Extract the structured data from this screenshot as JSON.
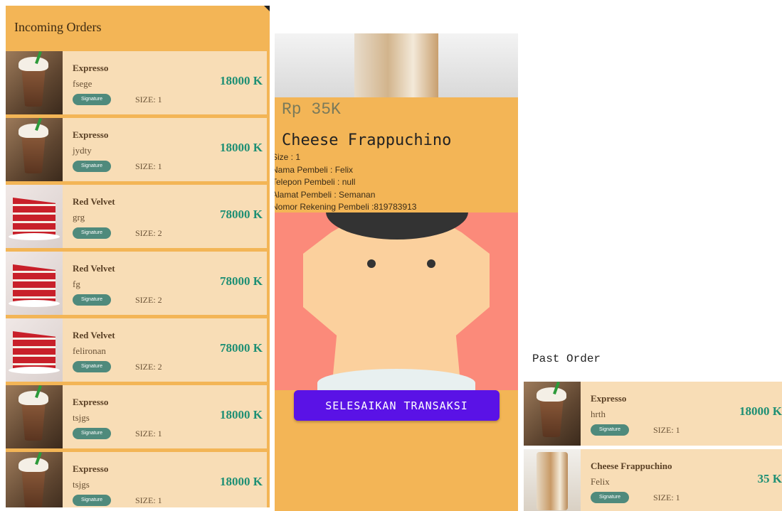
{
  "incoming": {
    "title": "Incoming Orders",
    "orders": [
      {
        "name": "Expresso",
        "buyer": "fsege",
        "badge": "Signature",
        "size": "SIZE: 1",
        "price": "18000 K",
        "thumb": "coffee"
      },
      {
        "name": "Expresso",
        "buyer": "jydty",
        "badge": "Signature",
        "size": "SIZE: 1",
        "price": "18000 K",
        "thumb": "coffee"
      },
      {
        "name": "Red Velvet",
        "buyer": "grg",
        "badge": "Signature",
        "size": "SIZE: 2",
        "price": "78000 K",
        "thumb": "cake"
      },
      {
        "name": "Red Velvet",
        "buyer": "fg",
        "badge": "Signature",
        "size": "SIZE: 2",
        "price": "78000 K",
        "thumb": "cake"
      },
      {
        "name": "Red Velvet",
        "buyer": "felironan",
        "badge": "Signature",
        "size": "SIZE: 2",
        "price": "78000 K",
        "thumb": "cake"
      },
      {
        "name": "Expresso",
        "buyer": "tsjgs",
        "badge": "Signature",
        "size": "SIZE: 1",
        "price": "18000 K",
        "thumb": "coffee"
      },
      {
        "name": "Expresso",
        "buyer": "tsjgs",
        "badge": "Signature",
        "size": "SIZE: 1",
        "price": "18000 K",
        "thumb": "coffee"
      }
    ]
  },
  "detail": {
    "price": "Rp 35K",
    "name": "Cheese Frappuchino",
    "lines": [
      "Size : 1",
      "Nama Pembeli : Felix",
      "Telepon Pembeli : null",
      "Alamat Pembeli : Semanan",
      "Nomor Rekening Pembeli :819783913"
    ],
    "cta_label": "SELESAIKAN TRANSAKSI"
  },
  "past": {
    "title": "Past Order",
    "orders": [
      {
        "name": "Expresso",
        "buyer": "hrth",
        "badge": "Signature",
        "size": "SIZE: 1",
        "price": "18000 K",
        "thumb": "coffee"
      },
      {
        "name": "Cheese Frappuchino",
        "buyer": "Felix",
        "badge": "Signature",
        "size": "SIZE: 1",
        "price": "35 K",
        "thumb": "frap"
      }
    ]
  },
  "colors": {
    "panel_bg": "#f3b556",
    "card_bg": "#f8ddb6",
    "price": "#1e8f74",
    "badge": "#4f8a7c",
    "cta": "#5a12e6",
    "avatar_bg": "#fb8a7a"
  }
}
